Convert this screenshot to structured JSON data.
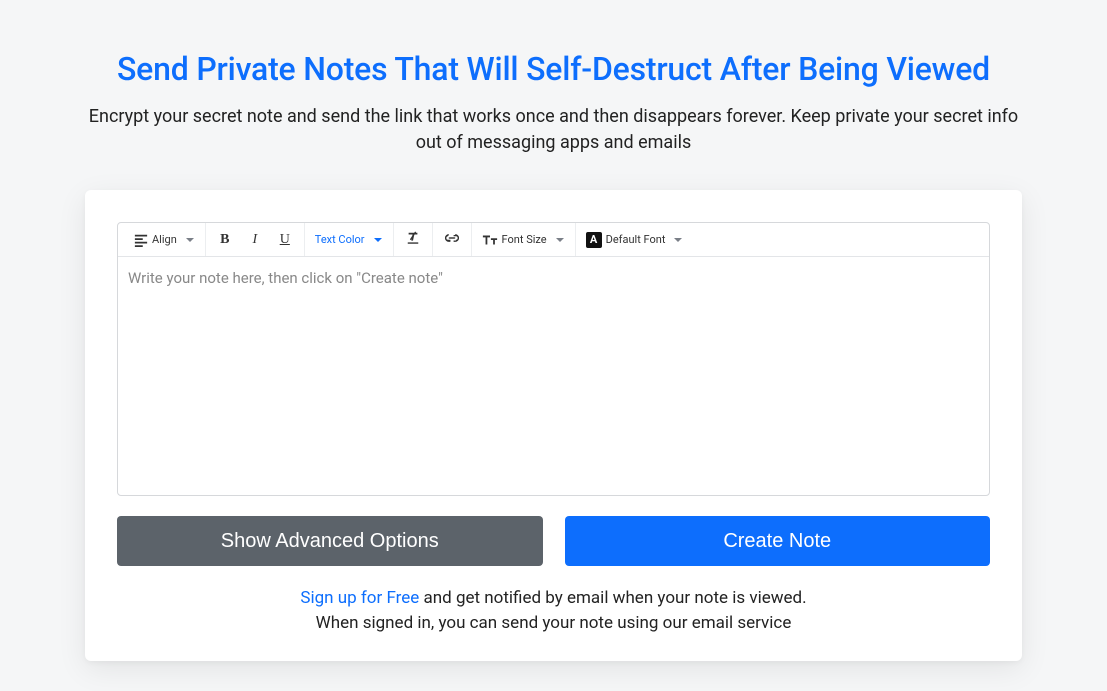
{
  "heading": "Send Private Notes That Will Self-Destruct After Being Viewed",
  "subtitle": "Encrypt your secret note and send the link that works once and then disappears forever. Keep private your secret info out of messaging apps and emails",
  "toolbar": {
    "align_label": "Align",
    "text_color_label": "Text Color",
    "font_size_label": "Font Size",
    "default_font_label": "Default Font"
  },
  "editor": {
    "placeholder": "Write your note here, then click on \"Create note\""
  },
  "buttons": {
    "advanced_label": "Show Advanced Options",
    "create_label": "Create Note"
  },
  "footer": {
    "signup_link": "Sign up for Free",
    "after_link": " and get notified by email when your note is viewed.",
    "line2": "When signed in, you can send your note using our email service"
  }
}
